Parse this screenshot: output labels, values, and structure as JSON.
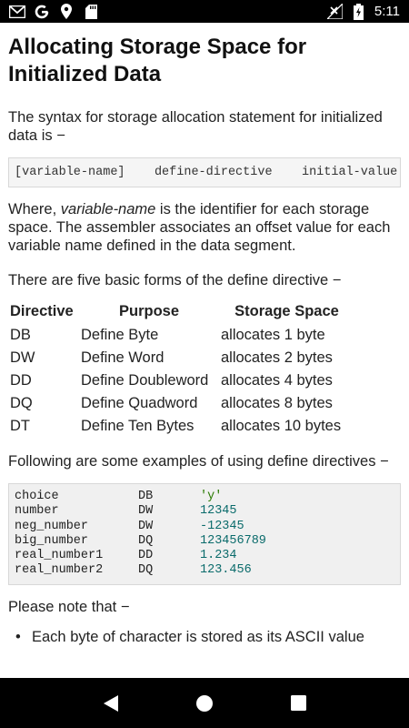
{
  "status_bar": {
    "time": "5:11",
    "icons": [
      "gmail-icon",
      "google-icon",
      "location-icon",
      "sd-card-icon",
      "no-signal-icon",
      "battery-charging-icon"
    ]
  },
  "article": {
    "title": "Allocating Storage Space for Initialized Data",
    "intro": "The syntax for storage allocation statement for initialized data is −",
    "syntax": {
      "part1": "[variable-name]",
      "part2": "define-directive",
      "part3": "initial-value"
    },
    "where_prefix": "Where, ",
    "where_em": "variable-name",
    "where_rest": " is the identifier for each storage space. The assembler associates an offset value for each variable name defined in the data segment.",
    "forms_intro": "There are five basic forms of the define directive −",
    "table": {
      "headers": [
        "Directive",
        "Purpose",
        "Storage Space"
      ],
      "rows": [
        [
          "DB",
          "Define Byte",
          "allocates 1 byte"
        ],
        [
          "DW",
          "Define Word",
          "allocates 2 bytes"
        ],
        [
          "DD",
          "Define Doubleword",
          "allocates 4 bytes"
        ],
        [
          "DQ",
          "Define Quadword",
          "allocates 8 bytes"
        ],
        [
          "DT",
          "Define Ten Bytes",
          "allocates 10 bytes"
        ]
      ]
    },
    "examples_intro": "Following are some examples of using define directives −",
    "examples": [
      [
        "choice",
        "DB",
        "'y'"
      ],
      [
        "number",
        "DW",
        "12345"
      ],
      [
        "neg_number",
        "DW",
        "-12345"
      ],
      [
        "big_number",
        "DQ",
        "123456789"
      ],
      [
        "real_number1",
        "DD",
        "1.234"
      ],
      [
        "real_number2",
        "DQ",
        "123.456"
      ]
    ],
    "note_intro": "Please note that −",
    "bullet_partial": "Each byte of character is stored as its ASCII value"
  },
  "nav_bar": {
    "buttons": [
      "back-icon",
      "home-icon",
      "recents-icon"
    ]
  }
}
